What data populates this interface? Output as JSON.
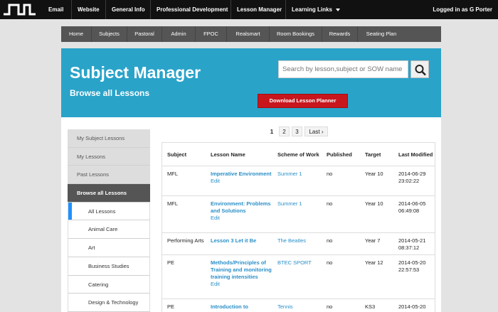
{
  "topnav": {
    "items": [
      "Email",
      "Website",
      "General Info",
      "Professional Development",
      "Lesson Manager",
      "Learning Links"
    ],
    "logged_in": "Logged in as G Porter"
  },
  "subnav": {
    "items": [
      "Home",
      "Subjects",
      "Pastoral",
      "Admin",
      "FPOC",
      "Realsmart",
      "Room Bookings",
      "Rewards",
      "Seating Plan"
    ]
  },
  "hero": {
    "title": "Subject Manager",
    "subtitle": "Browse all Lessons",
    "search_placeholder": "Search by lesson,subject or SOW name",
    "download_label": "Download Lesson Planner"
  },
  "sidebar": {
    "items": [
      {
        "label": "My Subject Lessons",
        "type": "section"
      },
      {
        "label": "My Lessons",
        "type": "section"
      },
      {
        "label": "Past Lessons",
        "type": "section"
      },
      {
        "label": "Browse all Lessons",
        "type": "active"
      },
      {
        "label": "All Lessons",
        "type": "sub",
        "selected": true
      },
      {
        "label": "Animal Care",
        "type": "sub"
      },
      {
        "label": "Art",
        "type": "sub"
      },
      {
        "label": "Business Studies",
        "type": "sub"
      },
      {
        "label": "Catering",
        "type": "sub"
      },
      {
        "label": "Design & Technology",
        "type": "sub"
      }
    ]
  },
  "pagination": {
    "pages": [
      "1",
      "2",
      "3",
      "Last ›"
    ],
    "current": "1"
  },
  "table": {
    "headers": [
      "Subject",
      "Lesson Name",
      "Scheme of Work",
      "Published",
      "Target",
      "Last Modified"
    ],
    "edit_label": "Edit",
    "rows": [
      {
        "subject": "MFL",
        "lesson": "Imperative Environment",
        "sow": "Summer 1",
        "published": "no",
        "target": "Year 10",
        "modified": "2014-06-29 23:02:22"
      },
      {
        "subject": "MFL",
        "lesson": "Environment: Problems and Solutions",
        "sow": "Summer 1",
        "published": "no",
        "target": "Year 10",
        "modified": "2014-06-05 06:49:08"
      },
      {
        "subject": "Performing Arts",
        "lesson": "Lesson 3 Let it Be",
        "sow": "The Beatles",
        "published": "no",
        "target": "Year 7",
        "modified": "2014-05-21 08:37:12"
      },
      {
        "subject": "PE",
        "lesson": "Methods/Principles of Training and monitoring training intensities",
        "sow": "BTEC SPORT",
        "published": "no",
        "target": "Year 12",
        "modified": "2014-05-20 22:57:53"
      },
      {
        "subject": "PE",
        "lesson": "Introduction to",
        "sow": "Tennis",
        "published": "no",
        "target": "KS3",
        "modified": "2014-05-20"
      }
    ]
  },
  "colors": {
    "hero": "#2aa3c9",
    "download": "#c8161d",
    "link": "#2a8fc8",
    "topbar": "#111111",
    "subnav": "#555555"
  }
}
